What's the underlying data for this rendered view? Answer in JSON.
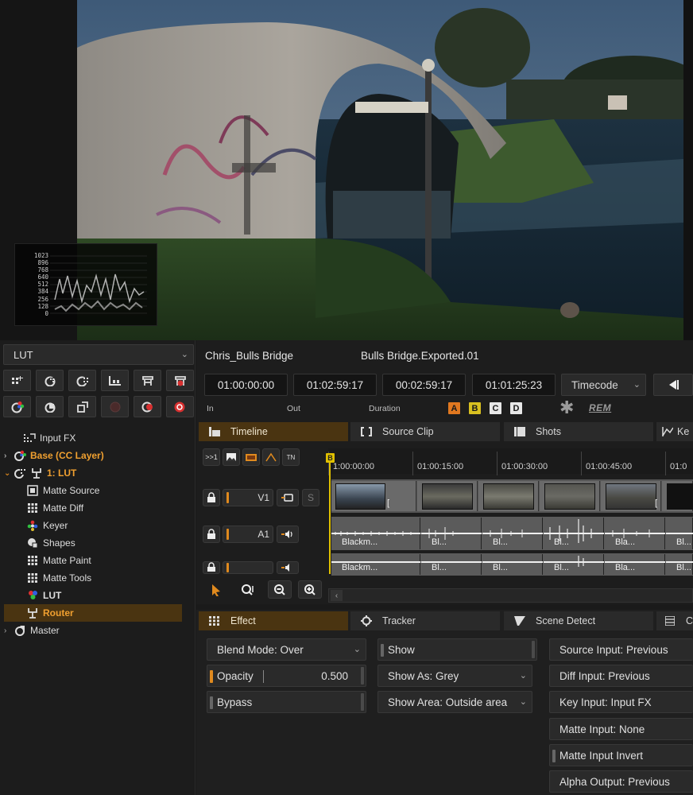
{
  "viewer": {
    "waveform_labels": [
      "1023",
      "896",
      "768",
      "640",
      "512",
      "384",
      "256",
      "128",
      "0"
    ]
  },
  "left_panel": {
    "lut_dropdown": "LUT",
    "tree": [
      {
        "label": "Input FX",
        "icon": "input-fx-icon"
      },
      {
        "label": "Base (CC Layer)",
        "icon": "cc-layer-icon"
      },
      {
        "label": "1: LUT",
        "icon": "lut-layer-icon"
      },
      {
        "label": "Matte Source",
        "icon": "matte-source-icon"
      },
      {
        "label": "Matte Diff",
        "icon": "matte-diff-icon"
      },
      {
        "label": "Keyer",
        "icon": "keyer-icon"
      },
      {
        "label": "Shapes",
        "icon": "shapes-icon"
      },
      {
        "label": "Matte Paint",
        "icon": "matte-paint-icon"
      },
      {
        "label": "Matte Tools",
        "icon": "matte-tools-icon"
      },
      {
        "label": "LUT",
        "icon": "lut-icon"
      },
      {
        "label": "Router",
        "icon": "router-icon"
      },
      {
        "label": "Master",
        "icon": "master-icon"
      }
    ]
  },
  "timeline": {
    "clip_name": "Chris_Bulls Bridge",
    "export_name": "Bulls Bridge.Exported.01",
    "tc_in": "01:00:00:00",
    "tc_out": "01:02:59:17",
    "tc_duration": "00:02:59:17",
    "tc_current": "01:01:25:23",
    "tc_mode": "Timecode",
    "label_in": "In",
    "label_out": "Out",
    "label_duration": "Duration",
    "abcd": [
      "A",
      "B",
      "C",
      "D"
    ],
    "rem": "REM",
    "tabs": {
      "timeline": "Timeline",
      "source_clip": "Source Clip",
      "shots": "Shots",
      "key": "Ke"
    },
    "track_buttons": {
      "tn": "TN",
      "v1": "V1",
      "s": "S",
      "a1": "A1"
    },
    "ruler": [
      "1:00:00:00",
      "01:00:15:00",
      "01:00:30:00",
      "01:00:45:00",
      "01:0"
    ],
    "playhead_marker": "B",
    "clip_bracket_1": "[",
    "clip_bracket_2": "[",
    "audio_clips_1": [
      "Blackm...",
      "Bl...",
      "Bl...",
      "Bl...",
      "Bla...",
      "Bl..."
    ],
    "audio_clips_2": [
      "Blackm...",
      "Bl...",
      "Bl...",
      "Bl...",
      "Bla...",
      "Bl..."
    ]
  },
  "effect_panel": {
    "tabs": {
      "effect": "Effect",
      "tracker": "Tracker",
      "scene_detect": "Scene Detect",
      "extra": "C"
    },
    "blend_mode": "Blend Mode: Over",
    "opacity_label": "Opacity",
    "opacity_value": "0.500",
    "bypass": "Bypass",
    "show": "Show",
    "show_as": "Show As: Grey",
    "show_area": "Show Area: Outside area",
    "source_input": "Source Input: Previous",
    "diff_input": "Diff Input: Previous",
    "key_input": "Key Input: Input FX",
    "matte_input": "Matte Input: None",
    "matte_input_invert": "Matte Input Invert",
    "alpha_output": "Alpha Output: Previous"
  },
  "colors": {
    "accent": "#f0a030",
    "active_tab": "#4a3411",
    "playhead": "#e0c000"
  }
}
